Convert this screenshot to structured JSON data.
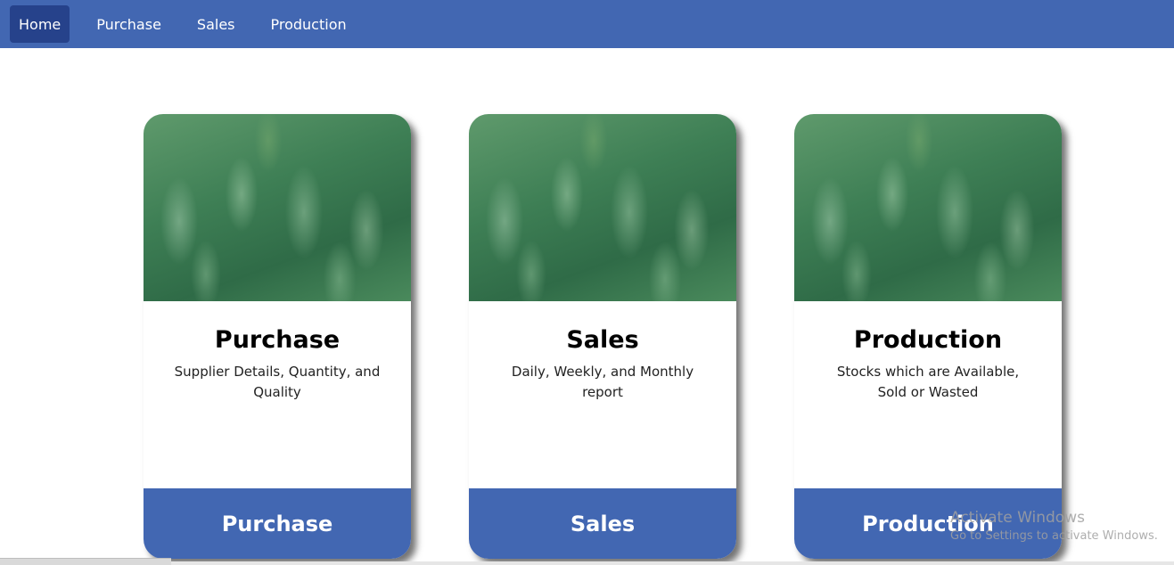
{
  "nav": {
    "items": [
      {
        "label": "Home",
        "active": true
      },
      {
        "label": "Purchase",
        "active": false
      },
      {
        "label": "Sales",
        "active": false
      },
      {
        "label": "Production",
        "active": false
      }
    ]
  },
  "cards": [
    {
      "title": "Purchase",
      "description": "Supplier Details, Quantity, and Quality",
      "button": "Purchase"
    },
    {
      "title": "Sales",
      "description": "Daily, Weekly, and Monthly report",
      "button": "Sales"
    },
    {
      "title": "Production",
      "description": "Stocks which are Available, Sold or Wasted",
      "button": "Production"
    }
  ],
  "watermark": {
    "title": "Activate Windows",
    "subtitle": "Go to Settings to activate Windows."
  },
  "colors": {
    "primary": "#4267b2",
    "active_nav": "#26428b"
  }
}
